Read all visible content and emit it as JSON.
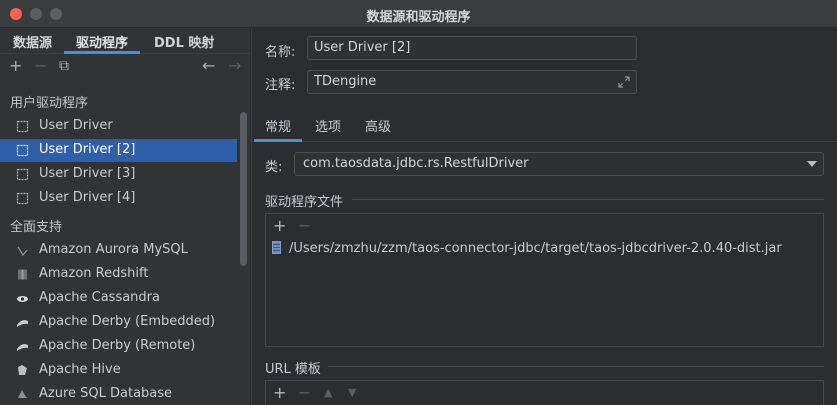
{
  "window": {
    "title": "数据源和驱动程序"
  },
  "left": {
    "tabs": [
      {
        "label": "数据源"
      },
      {
        "label": "驱动程序"
      },
      {
        "label": "DDL 映射"
      }
    ],
    "toolbar": {
      "add": "+",
      "remove": "−",
      "copy": "⧉",
      "back": "←",
      "forward": "→"
    },
    "sections": {
      "user": "用户驱动程序",
      "full": "全面支持"
    },
    "user_drivers": [
      {
        "label": "User Driver",
        "icon": "driver-icon"
      },
      {
        "label": "User Driver [2]",
        "icon": "driver-icon"
      },
      {
        "label": "User Driver [3]",
        "icon": "driver-icon"
      },
      {
        "label": "User Driver [4]",
        "icon": "driver-icon"
      }
    ],
    "supported": [
      {
        "label": "Amazon Aurora MySQL",
        "icon": "aurora-icon"
      },
      {
        "label": "Amazon Redshift",
        "icon": "redshift-icon"
      },
      {
        "label": "Apache Cassandra",
        "icon": "cassandra-icon"
      },
      {
        "label": "Apache Derby (Embedded)",
        "icon": "derby-icon"
      },
      {
        "label": "Apache Derby (Remote)",
        "icon": "derby-icon"
      },
      {
        "label": "Apache Hive",
        "icon": "hive-icon"
      },
      {
        "label": "Azure SQL Database",
        "icon": "azure-icon"
      }
    ]
  },
  "right": {
    "name": {
      "label": "名称:",
      "value": "User Driver [2]"
    },
    "comment": {
      "label": "注释:",
      "value": "TDengine"
    },
    "tabs": [
      {
        "label": "常规"
      },
      {
        "label": "选项"
      },
      {
        "label": "高级"
      }
    ],
    "class": {
      "label": "类:",
      "value": "com.taosdata.jdbc.rs.RestfulDriver"
    },
    "driver_files": {
      "title": "驱动程序文件",
      "add": "+",
      "remove": "−",
      "files": [
        "/Users/zmzhu/zzm/taos-connector-jdbc/target/taos-jdbcdriver-2.0.40-dist.jar"
      ]
    },
    "url_templates": {
      "title": "URL 模板",
      "add": "+",
      "remove": "−",
      "up": "▲",
      "down": "▼"
    }
  },
  "colors": {
    "accent": "#4e8bd8",
    "selection": "#2f5fa8"
  }
}
